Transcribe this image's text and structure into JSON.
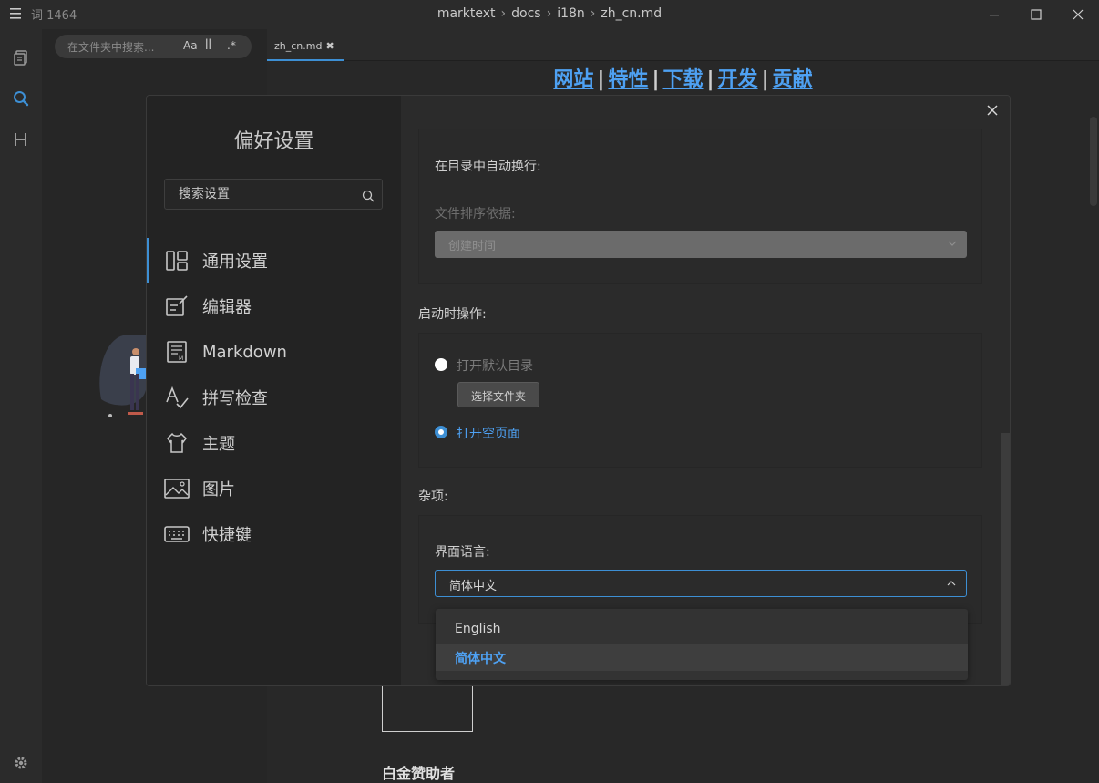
{
  "titlebar": {
    "word_count": "词 1464",
    "path": [
      "marktext",
      "docs",
      "i18n",
      "zh_cn.md"
    ]
  },
  "sidebar": {
    "search_placeholder": "在文件夹中搜索...",
    "options": [
      "Aa",
      "ꟾꟾ",
      ".*"
    ]
  },
  "tab": {
    "label": "zh_cn.md"
  },
  "document": {
    "links": [
      "网站",
      "特性",
      "下载",
      "开发",
      "贡献"
    ],
    "heading": "白金赞助者"
  },
  "preferences": {
    "title": "偏好设置",
    "search_placeholder": "搜索设置",
    "categories": [
      {
        "label": "通用设置",
        "icon": "general-settings-icon"
      },
      {
        "label": "编辑器",
        "icon": "editor-icon"
      },
      {
        "label": "Markdown",
        "icon": "markdown-icon"
      },
      {
        "label": "拼写检查",
        "icon": "spellcheck-icon"
      },
      {
        "label": "主题",
        "icon": "theme-icon"
      },
      {
        "label": "图片",
        "icon": "image-icon"
      },
      {
        "label": "快捷键",
        "icon": "keyboard-icon"
      }
    ],
    "general": {
      "wrap_toc_label": "在目录中自动换行:",
      "wrap_toc_enabled": false,
      "sort_by_label": "文件排序依据:",
      "sort_by_value": "创建时间",
      "startup_heading": "启动时操作:",
      "startup_options": [
        "打开默认目录",
        "打开空页面"
      ],
      "startup_selected": "打开空页面",
      "choose_folder_label": "选择文件夹",
      "misc_heading": "杂项:",
      "language_label": "界面语言:",
      "language_value": "简体中文",
      "language_options": [
        "English",
        "简体中文"
      ]
    }
  },
  "colors": {
    "accent": "#3d8fd4",
    "link": "#4ea1f3",
    "background": "#2b2b2b"
  }
}
